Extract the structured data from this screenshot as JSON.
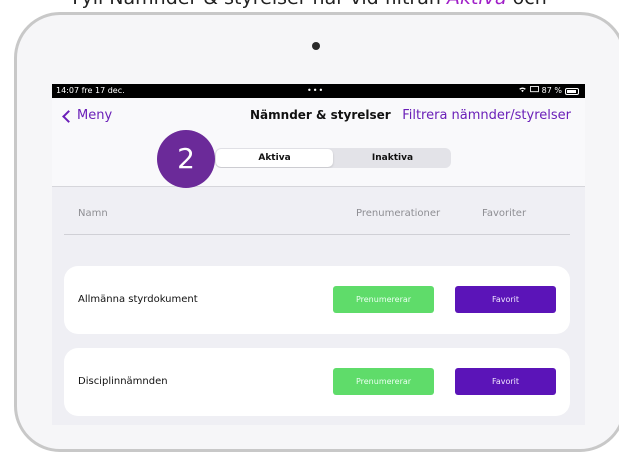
{
  "caption": {
    "before": "Fyll Nämnder & styrelser när vid filtran ",
    "highlight": "Aktiva",
    "after": " och"
  },
  "status_bar": {
    "time": "14:07  fre 17 dec.",
    "dots": "•••",
    "battery": "87 %"
  },
  "nav": {
    "back_label": "Meny",
    "title": "Nämnder & styrelser",
    "filter_label": "Filtrera nämnder/styrelser"
  },
  "segments": [
    {
      "label": "Aktiva",
      "selected": true
    },
    {
      "label": "Inaktiva",
      "selected": false
    }
  ],
  "step_badge": "2",
  "table": {
    "headers": [
      "Namn",
      "Prenumerationer",
      "Favoriter"
    ],
    "rows": [
      {
        "name": "Allmänna styrdokument",
        "subscribe_label": "Prenumererar",
        "favorite_label": "Favorit"
      },
      {
        "name": "Disciplinnämnden",
        "subscribe_label": "Prenumererar",
        "favorite_label": "Favorit"
      }
    ]
  },
  "colors": {
    "accent": "#6a1fb8",
    "subscribe_button": "#5fdc6a",
    "favorite_button": "#5b14b8",
    "step_badge": "#6b2a99"
  }
}
